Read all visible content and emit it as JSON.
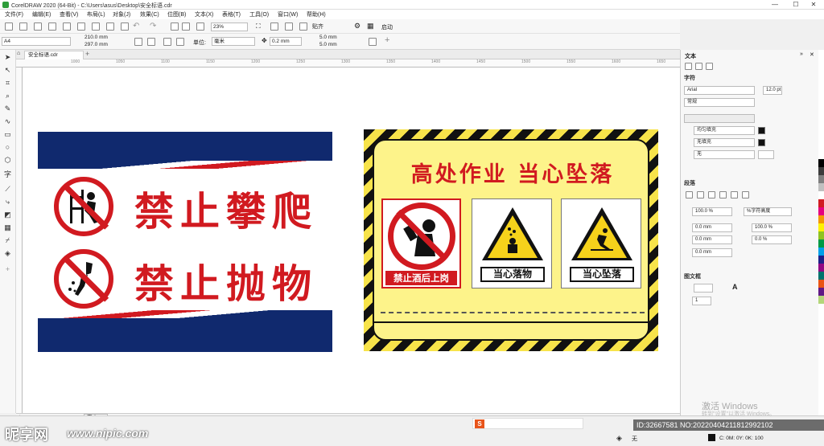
{
  "window": {
    "title": "CorelDRAW 2020 (64-Bit) - C:\\Users\\asus\\Desktop\\安全标语.cdr",
    "min": "—",
    "max": "☐",
    "close": "✕"
  },
  "menu": [
    "文件(F)",
    "编辑(E)",
    "查看(V)",
    "布局(L)",
    "对象(J)",
    "效果(C)",
    "位图(B)",
    "文本(X)",
    "表格(T)",
    "工具(O)",
    "窗口(W)",
    "帮助(H)"
  ],
  "toolbar1": {
    "zoom": "23%",
    "snap": "贴齐",
    "launch": "启动"
  },
  "toolbar2": {
    "page_size": "A4",
    "width": "210.0 mm",
    "height": "297.0 mm",
    "units_label": "单位:",
    "units": "毫米",
    "nudge": "0.2 mm",
    "dup_x": "5.0 mm",
    "dup_y": "5.0 mm"
  },
  "doc_tab": "安全标语.cdr",
  "ruler": [
    "1000",
    "1050",
    "1100",
    "1150",
    "1200",
    "1250",
    "1300",
    "1350",
    "1400",
    "1450",
    "1500",
    "1550",
    "1600",
    "1650",
    "1700"
  ],
  "sign1": {
    "line1": "禁止攀爬",
    "line2": "禁止抛物",
    "colors": {
      "navy": "#10296e",
      "red": "#d11a20"
    }
  },
  "sign2": {
    "title": "高处作业 当心坠落",
    "cards": [
      {
        "caption": "禁止酒后上岗",
        "icon": "no-drinking-icon"
      },
      {
        "caption": "当心落物",
        "icon": "falling-objects-warning-icon"
      },
      {
        "caption": "当心坠落",
        "icon": "fall-hazard-warning-icon"
      }
    ],
    "colors": {
      "yellow": "#fdf38a",
      "stripe": "#f7e34a"
    }
  },
  "panel": {
    "title": "文本",
    "char_section": "字符",
    "font": "Arial",
    "font_size": "12.0 pt",
    "style": "常规",
    "fill1": "均匀填充",
    "fill2": "无填充",
    "outline": "无",
    "para_section": "段落",
    "line_spacing": "100.0 %",
    "spacing_unit": "%字符高度",
    "before": "0.0 mm",
    "char_spacing": "100.0 %",
    "after": "0.0 mm",
    "word_spacing": "0.0 %",
    "indent": "0.0 mm",
    "frame_section": "图文框",
    "columns": "1"
  },
  "page_tab": "页 1",
  "status": {
    "id": "ID:32667581 NO:20220404211812992102",
    "cmyk": "C: 0M: 0Y: 0K: 100",
    "fill_none": "无"
  },
  "watermark": {
    "brand": "昵享网",
    "url": "www.nipic.com",
    "activate": "激活 Windows",
    "activate_sub": "转到\"设置\"以激活 Windows。"
  },
  "palette": [
    "#000000",
    "#3c3c3c",
    "#7f7f7f",
    "#bfbfbf",
    "#ffffff",
    "#d11a20",
    "#e4007f",
    "#f39800",
    "#fff100",
    "#8fc31f",
    "#009944",
    "#00a0e9",
    "#1d2088",
    "#920783",
    "#00736d",
    "#ea5413",
    "#601986",
    "#b4d67a"
  ]
}
